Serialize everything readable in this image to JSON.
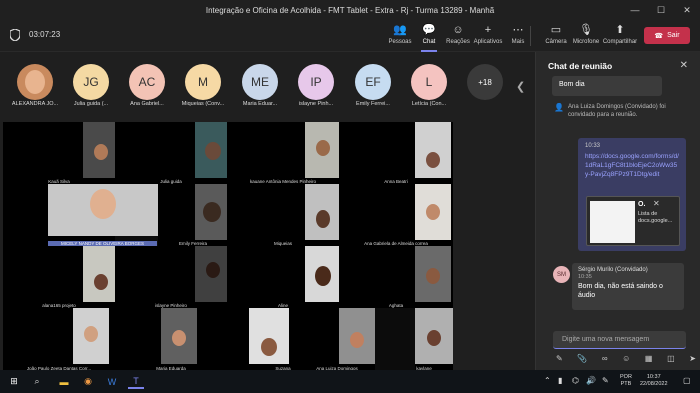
{
  "window": {
    "title": "Integração e Oficina de Acolhida - FMT Tablet - Extra - Rj - Turma 13289 - Manhã",
    "min": "—",
    "max": "☐",
    "close": "✕"
  },
  "toolbar": {
    "timer": "03:07:23",
    "people": "Pessoas",
    "chat": "Chat",
    "reactions": "Reações",
    "apps": "Aplicativos",
    "more": "Mais",
    "camera": "Câmera",
    "mic": "Microfone",
    "share": "Compartilhar",
    "leave": "Sair"
  },
  "participants": [
    {
      "initials": "",
      "name": "ALEXANDRA JO...",
      "color": "#c98a5e"
    },
    {
      "initials": "JG",
      "name": "Julia guida (...",
      "color": "#f4d9a3"
    },
    {
      "initials": "AC",
      "name": "Ana Gabriel...",
      "color": "#f3c3b5"
    },
    {
      "initials": "M",
      "name": "Miqueias (Conv...",
      "color": "#f6d9a5"
    },
    {
      "initials": "ME",
      "name": "Maria Eduar...",
      "color": "#c9d7ea"
    },
    {
      "initials": "IP",
      "name": "islayne Pinh...",
      "color": "#e7c8ea"
    },
    {
      "initials": "EF",
      "name": "Emily Ferrei...",
      "color": "#c6dcf1"
    },
    {
      "initials": "L",
      "name": "Letícia (Con...",
      "color": "#f4c3c0"
    }
  ],
  "more_participants": "+18",
  "grid": {
    "names": [
      "Kauã Silva",
      "Julia guida",
      "kauane Antônia Mendes Pinheiro",
      "Anna Beatri",
      "MICELY NANDY DE OLIVEIRA BORGES",
      "Emily Ferreira",
      "Miqueias",
      "Ana Gabriela de Almeida correa",
      "alana165 projeto",
      "islayne Pinheiro",
      "Aline",
      "Aghata",
      "João Paulo Zeeta Dantas Corr...",
      "Maria Eduarda",
      "Suzana",
      "Ana Luiza Domingos",
      "kaylane"
    ]
  },
  "chat": {
    "title": "Chat de reunião",
    "msg1": "Bom dia",
    "system": "Ana Luiza Domingos (Convidado) foi convidado para a reunião.",
    "my_time": "10:33",
    "link": "https://docs.google.com/forms/d/1dRaL1gFC8t1bloEjeC2oWw35y-PavjZq8FPz9T1Dtg/edit",
    "preview_title": "O.",
    "preview_desc": "Lista de docs.google...",
    "sender_initials": "SM",
    "sender": "Sérgio Murilo (Convidado)",
    "sender_time": "10:35",
    "sender_msg": "Bom dia, não está saindo o áudio",
    "compose_placeholder": "Digite uma nova mensagem"
  },
  "taskbar": {
    "lang": "POR",
    "layout": "PTB",
    "time": "10:37",
    "date": "22/08/2022"
  }
}
